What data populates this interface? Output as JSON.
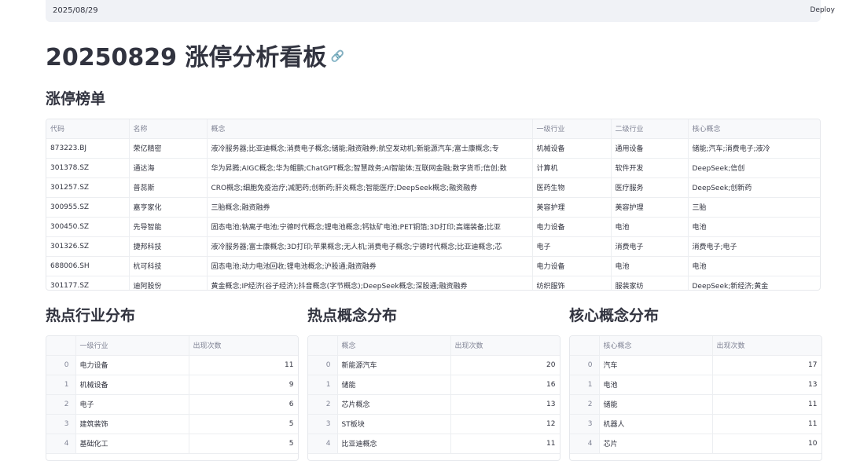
{
  "header": {
    "date": "2025/08/29",
    "deploy_label": "Deploy"
  },
  "title": "20250829 涨停分析看板",
  "link_icon": "🔗",
  "limit_up": {
    "heading": "涨停榜单",
    "columns": [
      "代码",
      "名称",
      "概念",
      "一级行业",
      "二级行业",
      "核心概念"
    ],
    "rows": [
      [
        "873223.BJ",
        "荣亿精密",
        "液冷服务器;比亚迪概念;消费电子概念;储能;融资融券;航空发动机;新能源汽车;富士康概念;专",
        "机械设备",
        "通用设备",
        "储能;汽车;消费电子;液冷"
      ],
      [
        "301378.SZ",
        "通达海",
        "华为昇腾;AIGC概念;华为鲲鹏;ChatGPT概念;智慧政务;AI智能体;互联网金融;数字货币;信创;数",
        "计算机",
        "软件开发",
        "DeepSeek;信创"
      ],
      [
        "301257.SZ",
        "普蕊斯",
        "CRO概念;细胞免疫治疗;减肥药;创新药;肝炎概念;智能医疗;DeepSeek概念;融资融券",
        "医药生物",
        "医疗服务",
        "DeepSeek;创新药"
      ],
      [
        "300955.SZ",
        "嘉亨家化",
        "三胎概念;融资融券",
        "美容护理",
        "美容护理",
        "三胎"
      ],
      [
        "300450.SZ",
        "先导智能",
        "固态电池;钠离子电池;宁德时代概念;锂电池概念;钙钛矿电池;PET铜箔;3D打印;高端装备;比亚",
        "电力设备",
        "电池",
        "电池"
      ],
      [
        "301326.SZ",
        "捷邦科技",
        "液冷服务器;富士康概念;3D打印;苹果概念;无人机;消费电子概念;宁德时代概念;比亚迪概念;芯",
        "电子",
        "消费电子",
        "消费电子;电子"
      ],
      [
        "688006.SH",
        "杭可科技",
        "固态电池;动力电池回收;锂电池概念;沪股通;融资融券",
        "电力设备",
        "电池",
        "电池"
      ],
      [
        "301177.SZ",
        "迪阿股份",
        "黄金概念;IP经济(谷子经济);抖音概念(字节概念);DeepSeek概念;深股通;融资融券",
        "纺织服饰",
        "服装家纺",
        "DeepSeek;新经济;黄金"
      ]
    ]
  },
  "industry": {
    "heading": "热点行业分布",
    "columns": [
      "一级行业",
      "出现次数"
    ],
    "rows": [
      [
        "0",
        "电力设备",
        "11"
      ],
      [
        "1",
        "机械设备",
        "9"
      ],
      [
        "2",
        "电子",
        "6"
      ],
      [
        "3",
        "建筑装饰",
        "5"
      ],
      [
        "4",
        "基础化工",
        "5"
      ]
    ]
  },
  "concept": {
    "heading": "热点概念分布",
    "columns": [
      "概念",
      "出现次数"
    ],
    "rows": [
      [
        "0",
        "新能源汽车",
        "20"
      ],
      [
        "1",
        "储能",
        "16"
      ],
      [
        "2",
        "芯片概念",
        "13"
      ],
      [
        "3",
        "ST板块",
        "12"
      ],
      [
        "4",
        "比亚迪概念",
        "11"
      ]
    ]
  },
  "core": {
    "heading": "核心概念分布",
    "columns": [
      "核心概念",
      "出现次数"
    ],
    "rows": [
      [
        "0",
        "汽车",
        "17"
      ],
      [
        "1",
        "电池",
        "13"
      ],
      [
        "2",
        "储能",
        "11"
      ],
      [
        "3",
        "机器人",
        "11"
      ],
      [
        "4",
        "芯片",
        "10"
      ]
    ]
  }
}
